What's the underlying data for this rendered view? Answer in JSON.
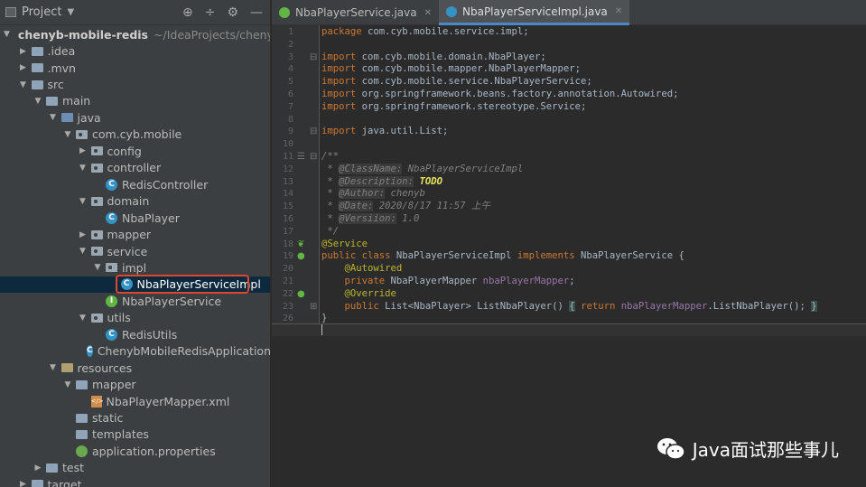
{
  "project_panel": {
    "title": "Project",
    "tools": [
      "⊕",
      "÷",
      "⚙",
      "—"
    ],
    "tree": [
      {
        "label": "chenyb-mobile-redis",
        "suffix": "~/IdeaProjects/chenyb-r",
        "arrow": "▼",
        "icon": "module-folder-icon",
        "indent": 0,
        "bold": true
      },
      {
        "label": ".idea",
        "arrow": "▶",
        "icon": "folder-icon",
        "indent": 1
      },
      {
        "label": ".mvn",
        "arrow": "▶",
        "icon": "folder-icon",
        "indent": 1
      },
      {
        "label": "src",
        "arrow": "▼",
        "icon": "folder-icon",
        "indent": 1
      },
      {
        "label": "main",
        "arrow": "▼",
        "icon": "folder-icon",
        "indent": 2
      },
      {
        "label": "java",
        "arrow": "▼",
        "icon": "source-folder-icon",
        "indent": 3
      },
      {
        "label": "com.cyb.mobile",
        "arrow": "▼",
        "icon": "package-icon",
        "indent": 4
      },
      {
        "label": "config",
        "arrow": "▶",
        "icon": "package-icon",
        "indent": 5
      },
      {
        "label": "controller",
        "arrow": "▼",
        "icon": "package-icon",
        "indent": 5
      },
      {
        "label": "RedisController",
        "arrow": "",
        "icon": "class-icon",
        "indent": 6
      },
      {
        "label": "domain",
        "arrow": "▼",
        "icon": "package-icon",
        "indent": 5
      },
      {
        "label": "NbaPlayer",
        "arrow": "",
        "icon": "class-icon",
        "indent": 6
      },
      {
        "label": "mapper",
        "arrow": "▶",
        "icon": "package-icon",
        "indent": 5
      },
      {
        "label": "service",
        "arrow": "▼",
        "icon": "package-icon",
        "indent": 5
      },
      {
        "label": "impl",
        "arrow": "▼",
        "icon": "package-icon",
        "indent": 6
      },
      {
        "label": "NbaPlayerServiceImpl",
        "arrow": "",
        "icon": "class-icon",
        "indent": 7,
        "selected": true
      },
      {
        "label": "NbaPlayerService",
        "arrow": "",
        "icon": "interface-icon",
        "indent": 6
      },
      {
        "label": "utils",
        "arrow": "▼",
        "icon": "package-icon",
        "indent": 5
      },
      {
        "label": "RedisUtils",
        "arrow": "",
        "icon": "class-icon",
        "indent": 6
      },
      {
        "label": "ChenybMobileRedisApplication",
        "arrow": "",
        "icon": "spring-class-icon",
        "indent": 5
      },
      {
        "label": "resources",
        "arrow": "▼",
        "icon": "resources-folder-icon",
        "indent": 3
      },
      {
        "label": "mapper",
        "arrow": "▼",
        "icon": "folder-icon",
        "indent": 4
      },
      {
        "label": "NbaPlayerMapper.xml",
        "arrow": "",
        "icon": "xml-file-icon",
        "indent": 5
      },
      {
        "label": "static",
        "arrow": "",
        "icon": "folder-icon",
        "indent": 4
      },
      {
        "label": "templates",
        "arrow": "",
        "icon": "folder-icon",
        "indent": 4
      },
      {
        "label": "application.properties",
        "arrow": "",
        "icon": "properties-file-icon",
        "indent": 4
      },
      {
        "label": "test",
        "arrow": "▶",
        "icon": "folder-icon",
        "indent": 2
      },
      {
        "label": "target",
        "arrow": "▶",
        "icon": "folder-icon",
        "indent": 1
      }
    ]
  },
  "tabs": [
    {
      "label": "NbaPlayerService.java",
      "active": false,
      "color": "#62b543"
    },
    {
      "label": "NbaPlayerServiceImpl.java",
      "active": true,
      "color": "#3592c4"
    }
  ],
  "editor": {
    "lines": [
      {
        "n": "1",
        "html": "<span class='kw'>package</span> com.cyb.mobile.service.impl;"
      },
      {
        "n": "2",
        "html": ""
      },
      {
        "n": "3",
        "html": "<span class='kw'>import</span> com.cyb.mobile.domain.NbaPlayer;"
      },
      {
        "n": "4",
        "html": "<span class='kw'>import</span> com.cyb.mobile.mapper.NbaPlayerMapper;"
      },
      {
        "n": "5",
        "html": "<span class='kw'>import</span> com.cyb.mobile.service.NbaPlayerService;"
      },
      {
        "n": "6",
        "html": "<span class='kw'>import</span> org.springframework.beans.factory.annotation.Autowired;"
      },
      {
        "n": "7",
        "html": "<span class='kw'>import</span> org.springframework.stereotype.Service;"
      },
      {
        "n": "8",
        "html": ""
      },
      {
        "n": "9",
        "html": "<span class='kw'>import</span> java.util.List;"
      },
      {
        "n": "10",
        "html": ""
      },
      {
        "n": "11",
        "html": "<span class='cm'>/**</span>"
      },
      {
        "n": "12",
        "html": "<span class='cm'> * <span class='tag'>@ClassName:</span> NbaPlayerServiceImpl</span>"
      },
      {
        "n": "13",
        "html": "<span class='cm'> * <span class='tag'>@Description:</span> <span class='todo'>TODO</span></span>"
      },
      {
        "n": "14",
        "html": "<span class='cm'> * <span class='tag'>@Author:</span> chenyb</span>"
      },
      {
        "n": "15",
        "html": "<span class='cm'> * <span class='tag'>@Date:</span> 2020/8/17 11:57 上午</span>"
      },
      {
        "n": "16",
        "html": "<span class='cm'> * <span class='tag'>@Versiion:</span> 1.0</span>"
      },
      {
        "n": "17",
        "html": "<span class='cm'> */</span>"
      },
      {
        "n": "18",
        "html": "<span class='ann'>@Service</span>"
      },
      {
        "n": "19",
        "html": "<span class='kw'>public class</span> NbaPlayerServiceImpl <span class='kw'>implements</span> NbaPlayerService {"
      },
      {
        "n": "20",
        "html": "    <span class='ann'>@Autowired</span>"
      },
      {
        "n": "21",
        "html": "    <span class='kw'>private</span> NbaPlayerMapper <span class='field'>nbaPlayerMapper</span>;"
      },
      {
        "n": "22",
        "html": "    <span class='ann'>@Override</span>"
      },
      {
        "n": "23",
        "html": "    <span class='kw'>public</span> List&lt;NbaPlayer&gt; ListNbaPlayer() <span class='fold'>{</span> <span class='kw'>return</span> <span class='field'>nbaPlayerMapper</span>.ListNbaPlayer(); <span class='fold'>}</span>"
      },
      {
        "n": "26",
        "html": "}"
      }
    ]
  },
  "watermark": {
    "text": "Java面试那些事儿"
  }
}
